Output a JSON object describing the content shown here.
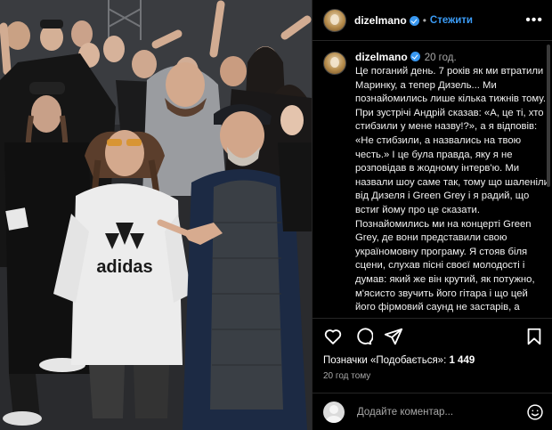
{
  "post": {
    "username": "dizelmano",
    "follow_label": "Стежити",
    "more_label": "•••",
    "caption_time": "20 год.",
    "caption_text": "Це поганий день. 7 років як ми втратили Маринку, а тепер Дизель... Ми познайомились лише кілька тижнів тому. При зустрічі Андрій сказав: «А, це ті, хто стибзили у мене назву!?», а я відповів: «Не стибзили, а назвались на твою честь.» І це була правда, яку я не розповідав в жодному інтерв'ю. Ми назвали шоу саме так, тому що шаленіли від Дизеля і Green Grey і я радий, що встиг йому про це сказати. Познайомились ми на концерті Green Grey, де вони представили свою україномовну програму. Я стояв біля сцени, слухав пісні своєї молодості і думав: який же він крутий, як потужно, м'ясисто звучить його гітара і що цей його фірмовий саунд не застарів, а звучить так само актуально"
  },
  "photo": {
    "hoodie_text": "adidas"
  },
  "actions": {
    "icons": [
      "heart-icon",
      "comment-icon",
      "share-icon",
      "bookmark-icon"
    ],
    "likes_prefix": "Позначки «Подобається»: ",
    "likes_count": "1 449",
    "post_time": "20 год тому"
  },
  "comment": {
    "placeholder": "Додайте коментар..."
  },
  "colors": {
    "accent": "#3b9cf6",
    "verified": "#3897f0",
    "background": "#000000",
    "divider": "#262626"
  }
}
